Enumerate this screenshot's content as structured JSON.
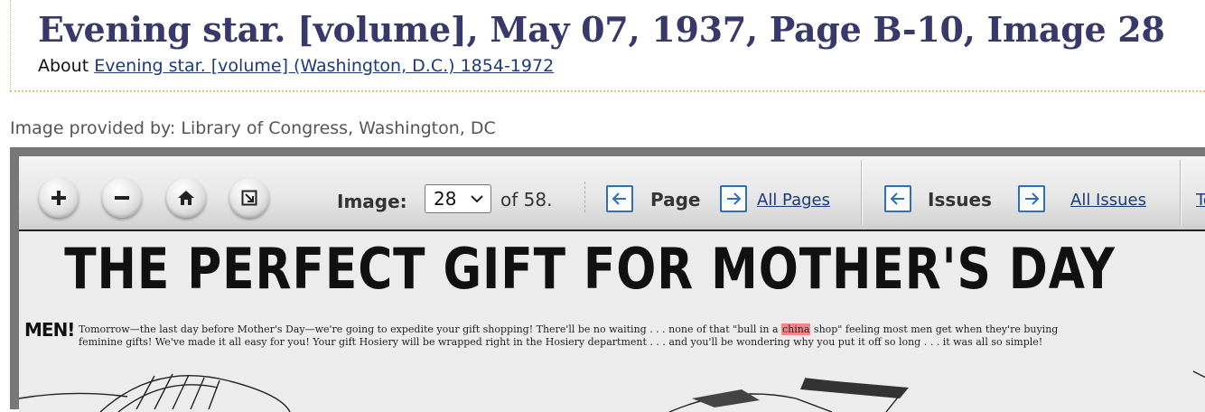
{
  "header": {
    "title": "Evening star. [volume], May 07, 1937, Page B-10, Image 28",
    "about_label": "About",
    "about_link": "Evening star. [volume] (Washington, D.C.) 1854-1972"
  },
  "provided_by": "Image provided by: Library of Congress, Washington, DC",
  "toolbar": {
    "zoom_in_icon": "plus-icon",
    "zoom_out_icon": "minus-icon",
    "home_icon": "home-icon",
    "fullscreen_icon": "fullscreen-icon",
    "image_label": "Image:",
    "image_selected": "28",
    "of_text": "of 58.",
    "page_label": "Page",
    "all_pages": "All Pages",
    "issues_label": "Issues",
    "all_issues": "All Issues",
    "truncated_link": "To"
  },
  "newspaper": {
    "headline": "THE PERFECT GIFT FOR MOTHER'S DAY",
    "lead": "MEN!",
    "line1_before": "Tomorrow—the last day before Mother's Day—we're going to expedite your gift shopping!  There'll be no waiting . . . none of that \"bull in a ",
    "line1_highlight": "china",
    "line1_after": " shop\" feeling most men get when they're buying",
    "line2": "feminine gifts!  We've made it all easy for you!  Your gift Hosiery will be wrapped right in the Hosiery department . . . and you'll be wondering why you put it off so long . . . it was all so simple!"
  },
  "colors": {
    "title": "#38396b",
    "link": "#1d3b7a",
    "arrow": "#2e6fb8",
    "highlight": "#f08888"
  }
}
